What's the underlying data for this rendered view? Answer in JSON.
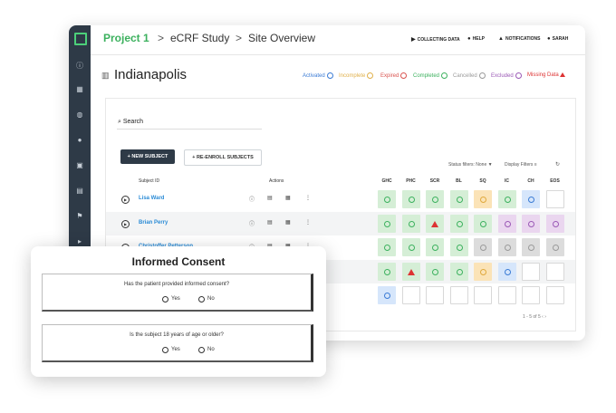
{
  "breadcrumb": {
    "project": "Project 1",
    "study": "eCRF Study",
    "page": "Site Overview",
    "separator": ">"
  },
  "topbar": {
    "status": "COLLECTING DATA",
    "help": "HELP",
    "notifications": "NOTIFICATIONS",
    "user": "SARAH"
  },
  "site": {
    "name": "Indianapolis"
  },
  "legend": [
    {
      "label": "Activated",
      "color": "#3a7bd5"
    },
    {
      "label": "Incomplete",
      "color": "#e0b04a"
    },
    {
      "label": "Expired",
      "color": "#d9534f"
    },
    {
      "label": "Completed",
      "color": "#3cb15e"
    },
    {
      "label": "Cancelled",
      "color": "#9a9a9a"
    },
    {
      "label": "Excluded",
      "color": "#9b59b6"
    },
    {
      "label": "Missing Data",
      "color": "#d33"
    }
  ],
  "search": {
    "label": "Search"
  },
  "buttons": {
    "new_subject": "NEW SUBJECT",
    "reenroll": "RE-ENROLL SUBJECTS"
  },
  "filters": {
    "status": "Status filters: None",
    "display": "Display Filters"
  },
  "table": {
    "col_subject": "Subject ID",
    "col_actions": "Actions",
    "phases": [
      "GHC",
      "PHC",
      "SCR",
      "BL",
      "SQ",
      "IC",
      "CH",
      "EOS"
    ],
    "rows": [
      {
        "subject": "Lisa Ward",
        "cells": [
          "completed",
          "completed",
          "completed",
          "completed",
          "incomplete",
          "completed",
          "activated",
          "empty"
        ]
      },
      {
        "subject": "Brian Perry",
        "cells": [
          "completed",
          "completed",
          "missing",
          "completed",
          "completed",
          "excluded",
          "excluded",
          "excluded"
        ]
      },
      {
        "subject": "Christoffer Petterson",
        "cells": [
          "completed",
          "completed",
          "completed",
          "completed",
          "cancelled",
          "cancelled",
          "cancelled",
          "cancelled"
        ]
      },
      {
        "subject": "",
        "cells": [
          "completed",
          "missing",
          "completed",
          "completed",
          "incomplete",
          "activated",
          "empty",
          "empty"
        ]
      },
      {
        "subject": "",
        "cells": [
          "activated",
          "empty",
          "empty",
          "empty",
          "empty",
          "empty",
          "empty",
          "empty"
        ]
      }
    ]
  },
  "pager": {
    "range": "1 - 5 of 5"
  },
  "modal": {
    "title": "Informed Consent",
    "questions": [
      {
        "text": "Has the patient provided informed consent?",
        "yes": "Yes",
        "no": "No"
      },
      {
        "text": "Is the subject 18 years of age or older?",
        "yes": "Yes",
        "no": "No"
      }
    ]
  },
  "colors": {
    "completed_bg": "#d5eed6",
    "completed_fg": "#3cb15e",
    "incomplete_bg": "#fbe3b7",
    "incomplete_fg": "#e0a93c",
    "activated_bg": "#d6e6fb",
    "activated_fg": "#3a7bd5",
    "excluded_bg": "#ead6ef",
    "excluded_fg": "#9b59b6",
    "cancelled_bg": "#dcdcdc",
    "cancelled_fg": "#9a9a9a",
    "missing_bg": "#d5eed6",
    "missing_fg": "#d33"
  }
}
